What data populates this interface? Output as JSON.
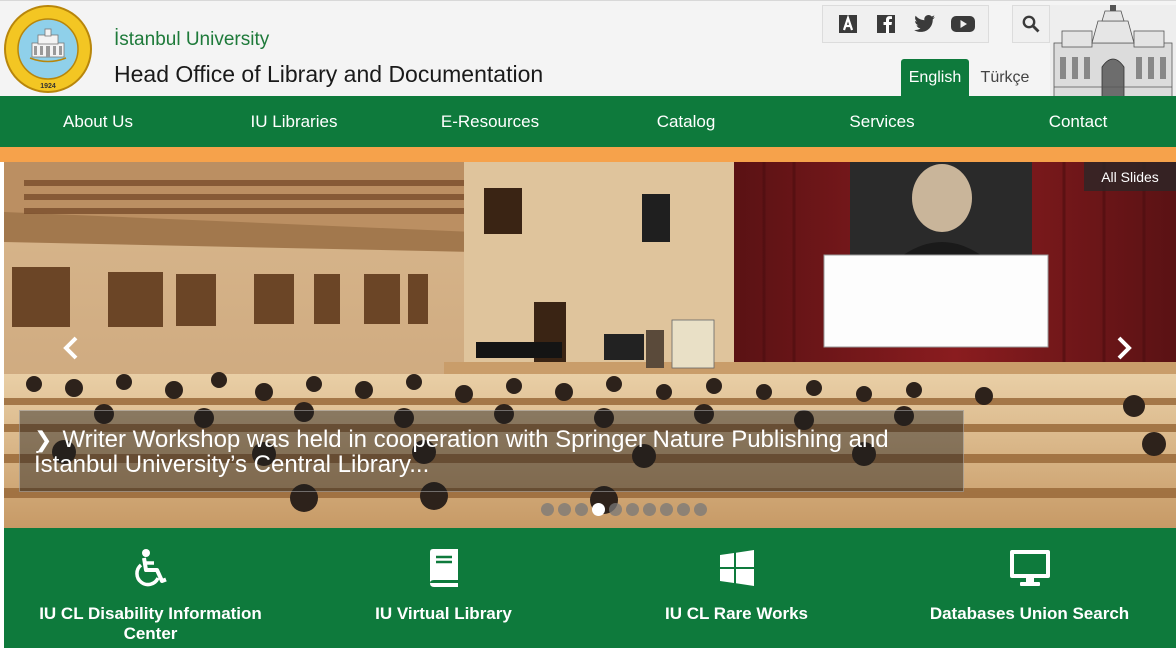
{
  "header": {
    "university": "İstanbul University",
    "department": "Head Office of Library and Documentation",
    "logo": {
      "ring_text": "T.C. İSTANBUL ÜNİVERSİTESİ MERKEZ KÜTÜPHANESİ",
      "year": "1924"
    },
    "social_icons": [
      "academia-icon",
      "facebook-icon",
      "twitter-icon",
      "youtube-icon"
    ],
    "search_icon": "search-icon",
    "languages": {
      "active": "English",
      "other": "Türkçe"
    }
  },
  "nav": {
    "items": [
      {
        "label": "About Us"
      },
      {
        "label": "IU Libraries"
      },
      {
        "label": "E-Resources"
      },
      {
        "label": "Catalog"
      },
      {
        "label": "Services"
      },
      {
        "label": "Contact"
      }
    ]
  },
  "slider": {
    "all_slides_label": "All Slides",
    "caption": "Writer Workshop was held in cooperation with Springer Nature Publishing and İstanbul University’s Central Library...",
    "slide_count": 10,
    "active_index": 3
  },
  "quick_links": [
    {
      "label": "IU CL Disability Information Center",
      "icon": "wheelchair-icon"
    },
    {
      "label": "IU Virtual Library",
      "icon": "book-icon"
    },
    {
      "label": "IU CL Rare Works",
      "icon": "windows-icon"
    },
    {
      "label": "Databases Union Search",
      "icon": "monitor-icon"
    }
  ],
  "colors": {
    "brand_green": "#0e7a3c",
    "accent_orange": "#f6a24b",
    "header_bg": "#f4f4f4"
  }
}
